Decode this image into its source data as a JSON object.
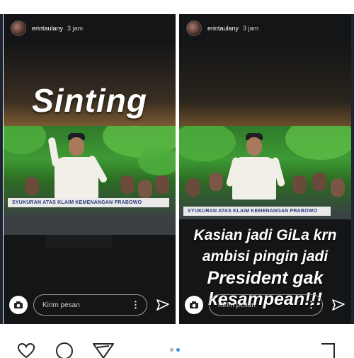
{
  "stories": [
    {
      "username": "erintaulany",
      "time": "3 jam",
      "overlay_title": "Sinting",
      "caption": "SYUKURAN ATAS KLAIM KEMENANGAN PRABOWO",
      "reply_placeholder": "Kirim pesan"
    },
    {
      "username": "erintaulany",
      "time": "3 jam",
      "overlay_lines": [
        "Kasian jadi GiLa krn",
        "ambisi pingin jadi",
        "President gak",
        "kesampean!!!"
      ],
      "caption": "SYUKURAN ATAS KLAIM KEMENANGAN PRABOWO",
      "reply_placeholder": "Kirim pesan"
    }
  ],
  "icons": {
    "camera": "camera-icon",
    "more": "more-options-icon",
    "send": "send-icon",
    "like": "heart-icon",
    "comment": "comment-icon",
    "share": "share-icon",
    "save": "bookmark-icon"
  },
  "pagination": {
    "count": 2,
    "active": 1
  },
  "colors": {
    "story_bg": "#141516",
    "active_dot": "#3a8fd8",
    "caption_text": "#2a3a7a"
  }
}
